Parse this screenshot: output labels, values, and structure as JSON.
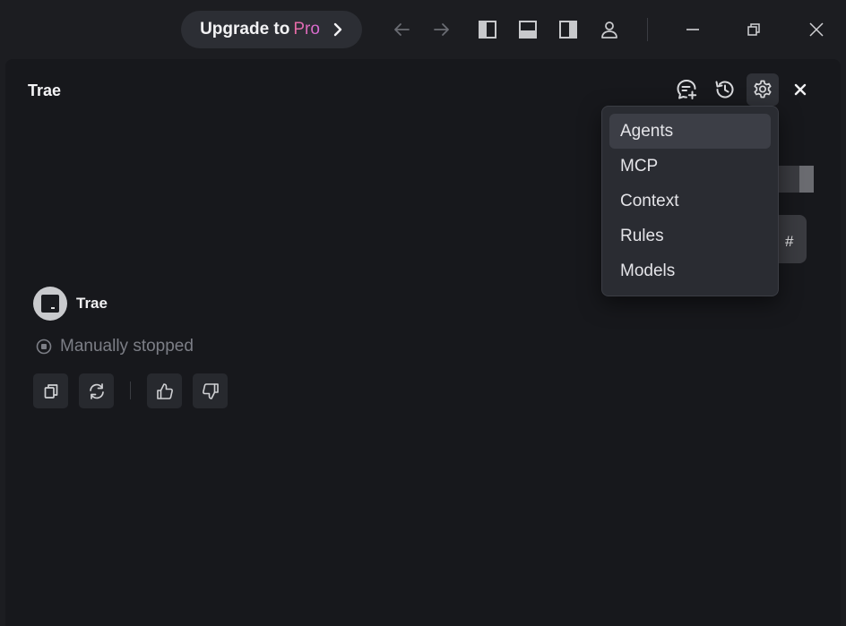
{
  "titlebar": {
    "upgrade_prefix": "Upgrade to",
    "upgrade_pro": "Pro",
    "icons": [
      "arrow-left-icon",
      "arrow-right-icon",
      "layout-left-panel-icon",
      "layout-bottom-panel-icon",
      "layout-right-panel-icon",
      "account-icon",
      "minimize-icon",
      "restore-icon",
      "close-icon"
    ]
  },
  "panel": {
    "title": "Trae",
    "header_icons": [
      "new-chat-icon",
      "history-icon",
      "settings-icon",
      "close-icon"
    ]
  },
  "menu": {
    "items": [
      {
        "label": "Agents",
        "selected": true
      },
      {
        "label": "MCP",
        "selected": false
      },
      {
        "label": "Context",
        "selected": false
      },
      {
        "label": "Rules",
        "selected": false
      },
      {
        "label": "Models",
        "selected": false
      }
    ]
  },
  "background_partial": {
    "bubble_text": "#"
  },
  "message": {
    "bot_name": "Trae",
    "status": "Manually stopped"
  },
  "colors": {
    "background": "#1c1d21",
    "panel": "#17181c",
    "menu": "#2a2c32",
    "pro_gradient_start": "#e86ba0",
    "pro_gradient_end": "#d66bd8"
  }
}
